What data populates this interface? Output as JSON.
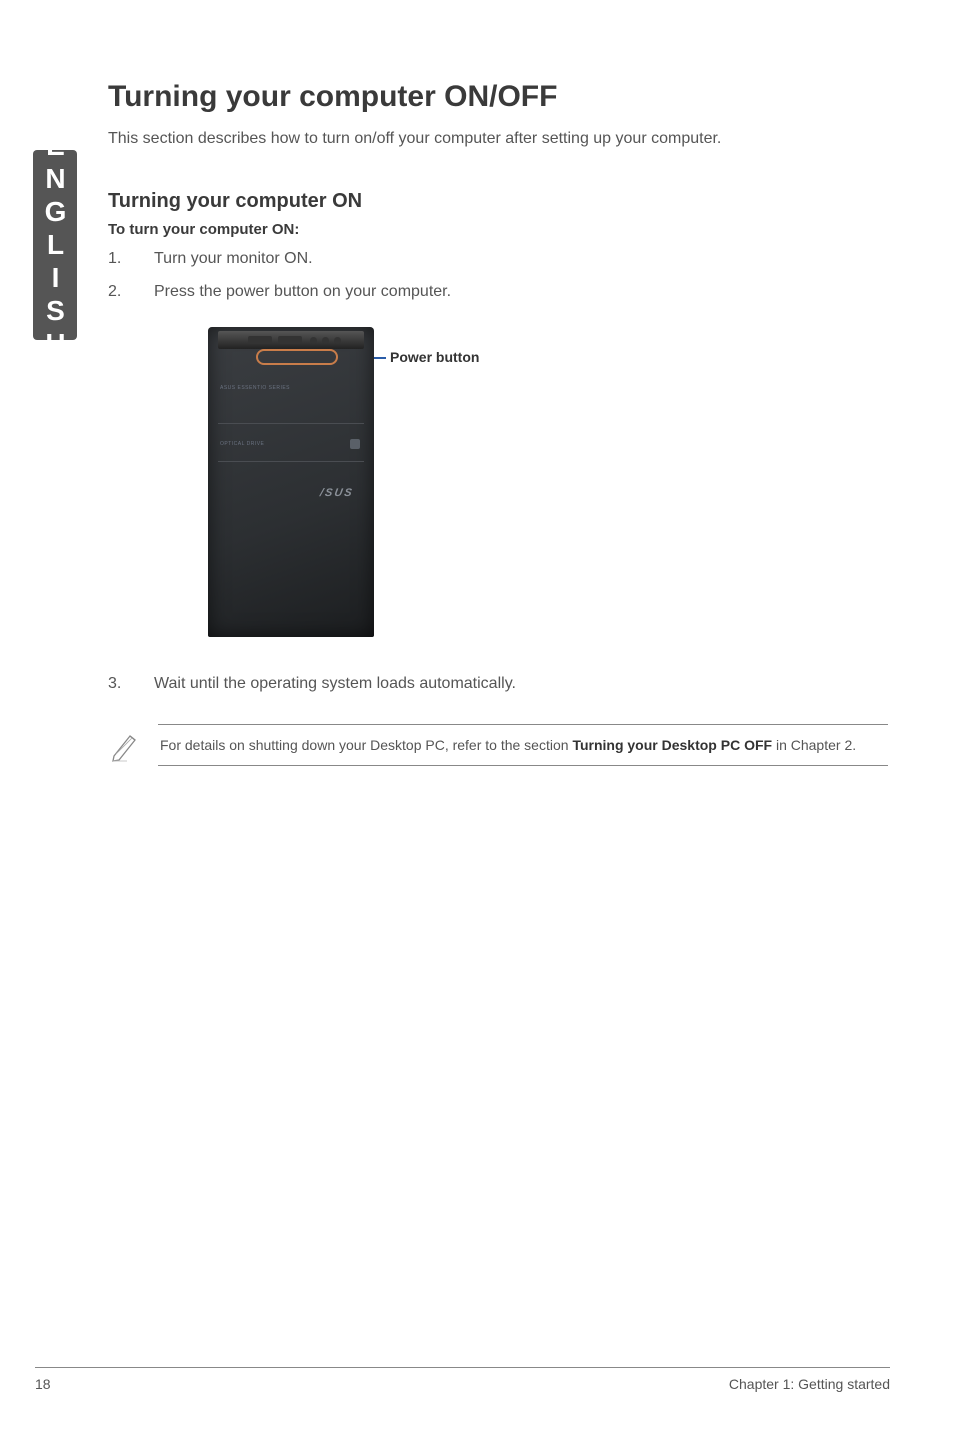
{
  "sidebar": {
    "language": "ENGLISH"
  },
  "main": {
    "title": "Turning your computer ON/OFF",
    "intro": "This section describes how to turn on/off your computer after setting up your computer.",
    "section_on": {
      "heading": "Turning your computer ON",
      "subheading": "To turn your computer ON:",
      "steps": [
        {
          "num": "1.",
          "text": "Turn your monitor ON."
        },
        {
          "num": "2.",
          "text": "Press the power button on your computer."
        },
        {
          "num": "3.",
          "text": "Wait until the operating system loads automatically."
        }
      ],
      "image": {
        "callout": "Power button",
        "label1": "ASUS ESSENTIO SERIES",
        "label2": "OPTICAL DRIVE",
        "logo": "/SUS"
      }
    },
    "note": {
      "pre": "For details on shutting down your Desktop PC, refer to the section ",
      "strong": "Turning your Desktop PC OFF",
      "post": " in Chapter 2."
    }
  },
  "footer": {
    "page": "18",
    "chapter": "Chapter 1: Getting started"
  }
}
